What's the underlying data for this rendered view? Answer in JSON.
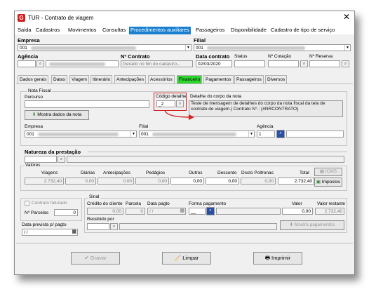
{
  "window": {
    "title": "TUR - Contrato de viagem",
    "accent": "#2fd52f"
  },
  "menu": [
    {
      "label": "Saída"
    },
    {
      "label": "Cadastros"
    },
    {
      "label": "Movimentos"
    },
    {
      "label": "Consultas"
    },
    {
      "label": "Procedimentos auxiliares"
    },
    {
      "label": "Passageiros"
    },
    {
      "label": "Disponibilidade"
    },
    {
      "label": "Cadastro de tipo de serviço"
    }
  ],
  "header": {
    "empresa_label": "Empresa",
    "empresa_value": "001",
    "filial_label": "Filial",
    "filial_value": "001",
    "agencia_label": "Agência",
    "nro_contrato_label": "Nº Contrato",
    "nro_contrato_value": "Gerado no fim do cadastro...",
    "data_contrato_label": "Data contrato",
    "data_contrato_value": "02/03/2020",
    "status_label": "Status",
    "nro_cotacao_label": "Nº Cotação",
    "nro_reserva_label": "Nº Reserva"
  },
  "tabs": [
    {
      "label": "Dados gerais"
    },
    {
      "label": "Datas"
    },
    {
      "label": "Viagem"
    },
    {
      "label": "Itinerário"
    },
    {
      "label": "Antecipações"
    },
    {
      "label": "Acessórios"
    },
    {
      "label": "Financeiro"
    },
    {
      "label": "Pagamentos"
    },
    {
      "label": "Passageiros"
    },
    {
      "label": "Diversos"
    }
  ],
  "nota": {
    "group_label": "Nota Fiscal",
    "percurso_label": "Percurso",
    "codigo_label": "Código detalhe",
    "codigo_value": "_2",
    "detalhe_label": "Detalhe do corpo da nota",
    "detalhe_text": "Teste de mensagem de detalhes do corpo da nota fiscal da tela de contrato de viagem.| Contrato N°.: {#NRCONTRATO}",
    "mostra_button": "Mostra dados da nota",
    "empresa_label": "Empresa",
    "empresa_value": "001",
    "filial_label": "Filial",
    "filial_value": "001",
    "agencia_label": "Agência",
    "agencia_value": "1"
  },
  "natureza": {
    "label": "Natureza da prestação"
  },
  "valores": {
    "group_label": "Valores",
    "headers": [
      "Viagens",
      "Diárias",
      "Antecipações",
      "Pedágios",
      "Outros",
      "Desconto",
      "Dscto Poltronas",
      "Total"
    ],
    "values": [
      "2.732,40",
      "0,00",
      "0,00",
      "0,00",
      "0,00",
      "0,00",
      "0,00",
      "2.732,40"
    ],
    "icms_button": "ICMS",
    "impostos_button": "Impostos"
  },
  "faturado": {
    "checkbox_label": "Contrato faturado",
    "parcelas_label": "Nº Parcelas",
    "parcelas_value": "0",
    "data_prevista_label": "Data prevista p/ pagto",
    "data_prevista_value": "/ /"
  },
  "sinal": {
    "group_label": "Sinal",
    "credito_label": "Crédito do cliente",
    "credito_value": "0,00",
    "parcela_label": "Parcela",
    "parcela_value": "0",
    "data_pagto_label": "Data pagto",
    "data_pagto_value": "/ /",
    "forma_label": "Forma pagamento",
    "forma_value": "__",
    "valor_label": "Valor",
    "valor_value": "0,00",
    "restante_label": "Valor restante",
    "restante_value": "2.732,40",
    "recebido_label": "Recebido por",
    "mostra_pag_button": "Mostra pagamentos"
  },
  "footer": {
    "gravar": "Gravar",
    "limpar": "Limpar",
    "imprimir": "Imprimir"
  }
}
